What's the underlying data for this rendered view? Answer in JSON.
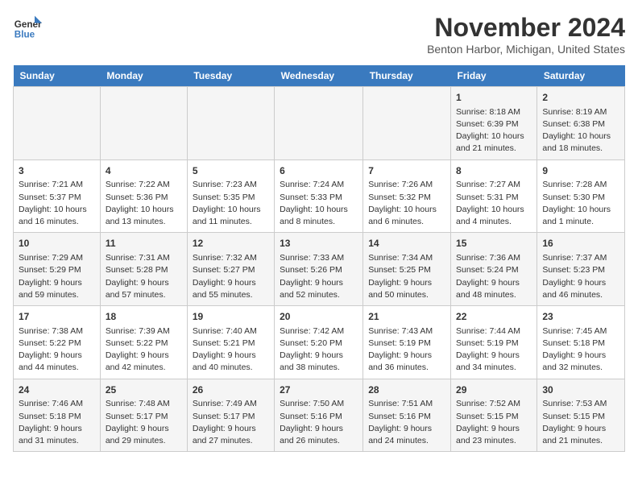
{
  "header": {
    "logo_line1": "General",
    "logo_line2": "Blue",
    "title": "November 2024",
    "subtitle": "Benton Harbor, Michigan, United States"
  },
  "days_of_week": [
    "Sunday",
    "Monday",
    "Tuesday",
    "Wednesday",
    "Thursday",
    "Friday",
    "Saturday"
  ],
  "weeks": [
    [
      {
        "day": "",
        "info": ""
      },
      {
        "day": "",
        "info": ""
      },
      {
        "day": "",
        "info": ""
      },
      {
        "day": "",
        "info": ""
      },
      {
        "day": "",
        "info": ""
      },
      {
        "day": "1",
        "info": "Sunrise: 8:18 AM\nSunset: 6:39 PM\nDaylight: 10 hours and 21 minutes."
      },
      {
        "day": "2",
        "info": "Sunrise: 8:19 AM\nSunset: 6:38 PM\nDaylight: 10 hours and 18 minutes."
      }
    ],
    [
      {
        "day": "3",
        "info": "Sunrise: 7:21 AM\nSunset: 5:37 PM\nDaylight: 10 hours and 16 minutes."
      },
      {
        "day": "4",
        "info": "Sunrise: 7:22 AM\nSunset: 5:36 PM\nDaylight: 10 hours and 13 minutes."
      },
      {
        "day": "5",
        "info": "Sunrise: 7:23 AM\nSunset: 5:35 PM\nDaylight: 10 hours and 11 minutes."
      },
      {
        "day": "6",
        "info": "Sunrise: 7:24 AM\nSunset: 5:33 PM\nDaylight: 10 hours and 8 minutes."
      },
      {
        "day": "7",
        "info": "Sunrise: 7:26 AM\nSunset: 5:32 PM\nDaylight: 10 hours and 6 minutes."
      },
      {
        "day": "8",
        "info": "Sunrise: 7:27 AM\nSunset: 5:31 PM\nDaylight: 10 hours and 4 minutes."
      },
      {
        "day": "9",
        "info": "Sunrise: 7:28 AM\nSunset: 5:30 PM\nDaylight: 10 hours and 1 minute."
      }
    ],
    [
      {
        "day": "10",
        "info": "Sunrise: 7:29 AM\nSunset: 5:29 PM\nDaylight: 9 hours and 59 minutes."
      },
      {
        "day": "11",
        "info": "Sunrise: 7:31 AM\nSunset: 5:28 PM\nDaylight: 9 hours and 57 minutes."
      },
      {
        "day": "12",
        "info": "Sunrise: 7:32 AM\nSunset: 5:27 PM\nDaylight: 9 hours and 55 minutes."
      },
      {
        "day": "13",
        "info": "Sunrise: 7:33 AM\nSunset: 5:26 PM\nDaylight: 9 hours and 52 minutes."
      },
      {
        "day": "14",
        "info": "Sunrise: 7:34 AM\nSunset: 5:25 PM\nDaylight: 9 hours and 50 minutes."
      },
      {
        "day": "15",
        "info": "Sunrise: 7:36 AM\nSunset: 5:24 PM\nDaylight: 9 hours and 48 minutes."
      },
      {
        "day": "16",
        "info": "Sunrise: 7:37 AM\nSunset: 5:23 PM\nDaylight: 9 hours and 46 minutes."
      }
    ],
    [
      {
        "day": "17",
        "info": "Sunrise: 7:38 AM\nSunset: 5:22 PM\nDaylight: 9 hours and 44 minutes."
      },
      {
        "day": "18",
        "info": "Sunrise: 7:39 AM\nSunset: 5:22 PM\nDaylight: 9 hours and 42 minutes."
      },
      {
        "day": "19",
        "info": "Sunrise: 7:40 AM\nSunset: 5:21 PM\nDaylight: 9 hours and 40 minutes."
      },
      {
        "day": "20",
        "info": "Sunrise: 7:42 AM\nSunset: 5:20 PM\nDaylight: 9 hours and 38 minutes."
      },
      {
        "day": "21",
        "info": "Sunrise: 7:43 AM\nSunset: 5:19 PM\nDaylight: 9 hours and 36 minutes."
      },
      {
        "day": "22",
        "info": "Sunrise: 7:44 AM\nSunset: 5:19 PM\nDaylight: 9 hours and 34 minutes."
      },
      {
        "day": "23",
        "info": "Sunrise: 7:45 AM\nSunset: 5:18 PM\nDaylight: 9 hours and 32 minutes."
      }
    ],
    [
      {
        "day": "24",
        "info": "Sunrise: 7:46 AM\nSunset: 5:18 PM\nDaylight: 9 hours and 31 minutes."
      },
      {
        "day": "25",
        "info": "Sunrise: 7:48 AM\nSunset: 5:17 PM\nDaylight: 9 hours and 29 minutes."
      },
      {
        "day": "26",
        "info": "Sunrise: 7:49 AM\nSunset: 5:17 PM\nDaylight: 9 hours and 27 minutes."
      },
      {
        "day": "27",
        "info": "Sunrise: 7:50 AM\nSunset: 5:16 PM\nDaylight: 9 hours and 26 minutes."
      },
      {
        "day": "28",
        "info": "Sunrise: 7:51 AM\nSunset: 5:16 PM\nDaylight: 9 hours and 24 minutes."
      },
      {
        "day": "29",
        "info": "Sunrise: 7:52 AM\nSunset: 5:15 PM\nDaylight: 9 hours and 23 minutes."
      },
      {
        "day": "30",
        "info": "Sunrise: 7:53 AM\nSunset: 5:15 PM\nDaylight: 9 hours and 21 minutes."
      }
    ]
  ]
}
